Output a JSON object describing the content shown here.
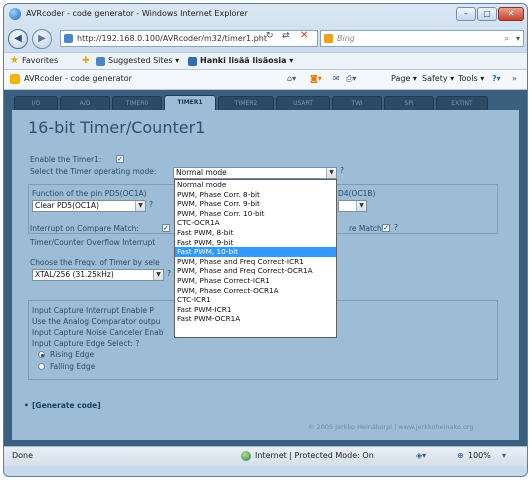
{
  "window": {
    "title": "AVRcoder - code generator - Windows Internet Explorer",
    "minimize": "–",
    "maximize": "▢",
    "close": "✕"
  },
  "address_bar": {
    "url": "http://192.168.0.100/AVRcoder/m32/timer1.pht",
    "search_placeholder": "Bing"
  },
  "favorites_bar": {
    "favorites": "Favorites",
    "suggested_sites": "Suggested Sites ▾",
    "get_more": "Hanki lisää lisäosia ▾"
  },
  "command_bar": {
    "tab_title": "AVRcoder - code generator",
    "page_menu": "Page ▾",
    "safety_menu": "Safety ▾",
    "tools_menu": "Tools ▾"
  },
  "app_tabs": [
    {
      "label": "I/O"
    },
    {
      "label": "A/D"
    },
    {
      "label": "TIMER0"
    },
    {
      "label": "TIMER1"
    },
    {
      "label": "TIMER2"
    },
    {
      "label": "USART"
    },
    {
      "label": "TWI"
    },
    {
      "label": "SPI"
    },
    {
      "label": "EXTINT"
    }
  ],
  "content": {
    "heading": "16-bit Timer/Counter1",
    "enable_label": "Enable the Timer1:",
    "enable_checked": "✓",
    "mode_label": "Select the Timer operating mode:",
    "mode_selected": "Normal mode",
    "mode_help": "?",
    "oc1a_label": "Function of the pin PD5(OC1A)",
    "oc1a_value": "Clear PD5(OC1A)",
    "oc1a_help": "?",
    "oc1b_label": "D4(OC1B)",
    "interrupt_compare_label": "Interrupt on Compare Match:",
    "interrupt_compare_label_b": "re Match:",
    "interrupt_help": "?",
    "overflow_label": "Timer/Counter Overflow Interrupt",
    "prescaler_label": "Choose the Freqv. of Timer by sele",
    "prescaler_value": "XTAL/256 (31.25kHz)",
    "prescaler_help": "?",
    "ic_interrupt_label": "Input Capture Interrupt Enable P",
    "analog_comp_label": "Use the Analog Comparator outpu",
    "noise_canceler_label": "Input Capture Noise Canceler Enab",
    "edge_select_label": "Input Capture Edge Select: ?",
    "rising_edge": "Rising Edge",
    "falling_edge": "Falling Edge",
    "generate_code": "[Generate code]",
    "bullet": "•",
    "footer": "© 2005 Jerkko Heinäkorpi | www.jerkkoheinako.org"
  },
  "mode_options": [
    "Normal mode",
    "PWM, Phase Corr. 8-bit",
    "PWM, Phase Corr. 9-bit",
    "PWM, Phase Corr. 10-bit",
    "CTC-OCR1A",
    "Fast PWM, 8-bit",
    "Fast PWM, 9-bit",
    "Fast PWM, 10-bit",
    "PWM, Phase and Freq Correct-ICR1",
    "PWM, Phase and Freq Correct-OCR1A",
    "PWM, Phase Correct-ICR1",
    "PWM, Phase Correct-OCR1A",
    "CTC-ICR1",
    "Fast PWM-ICR1",
    "Fast PWM-OCR1A"
  ],
  "highlighted_option": "Fast PWM, 10-bit",
  "status_bar": {
    "status": "Done",
    "zone": "Internet | Protected Mode: On",
    "zoom": "100%"
  }
}
